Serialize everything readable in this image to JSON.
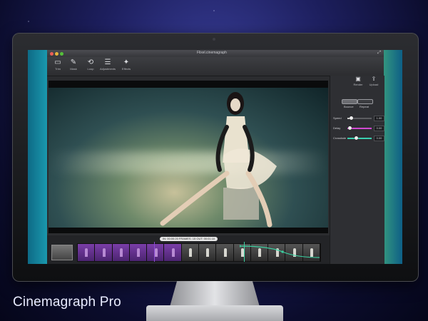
{
  "window": {
    "title": "Flixel.cinemagraph"
  },
  "toolbar": {
    "items": [
      {
        "label": "Trim",
        "icon": "trim-icon",
        "glyph": "▭"
      },
      {
        "label": "Mask",
        "icon": "brush-icon",
        "glyph": "✎"
      },
      {
        "label": "Loop",
        "icon": "loop-icon",
        "glyph": "⟲"
      },
      {
        "label": "Adjustments",
        "icon": "adjustments-icon",
        "glyph": "☰"
      },
      {
        "label": "Effects",
        "icon": "effects-icon",
        "glyph": "✦"
      }
    ]
  },
  "panel": {
    "render_label": "Render",
    "upload_label": "Upload",
    "modes": {
      "bounce": "Bounce",
      "repeat": "Repeat"
    },
    "sliders": [
      {
        "label": "Speed",
        "value": "1.00",
        "fraction": 0.15,
        "color": "#cfcfcf"
      },
      {
        "label": "Delay",
        "value": "0.00",
        "fraction": 0.1,
        "color": "#d14ad1"
      },
      {
        "label": "Crossfade",
        "value": "0.00",
        "fraction": 0.35,
        "color": "#3ad0b0"
      }
    ]
  },
  "timeline": {
    "timecode": "IN: 00:00:20  FRAMES: 15  OUT: 00:01:10",
    "frames": 14,
    "selected_frames": 6,
    "accent_in": "#8a4bd0",
    "accent_out": "#3ad0a0"
  },
  "branding": {
    "text": "Cinemagraph Pro"
  }
}
